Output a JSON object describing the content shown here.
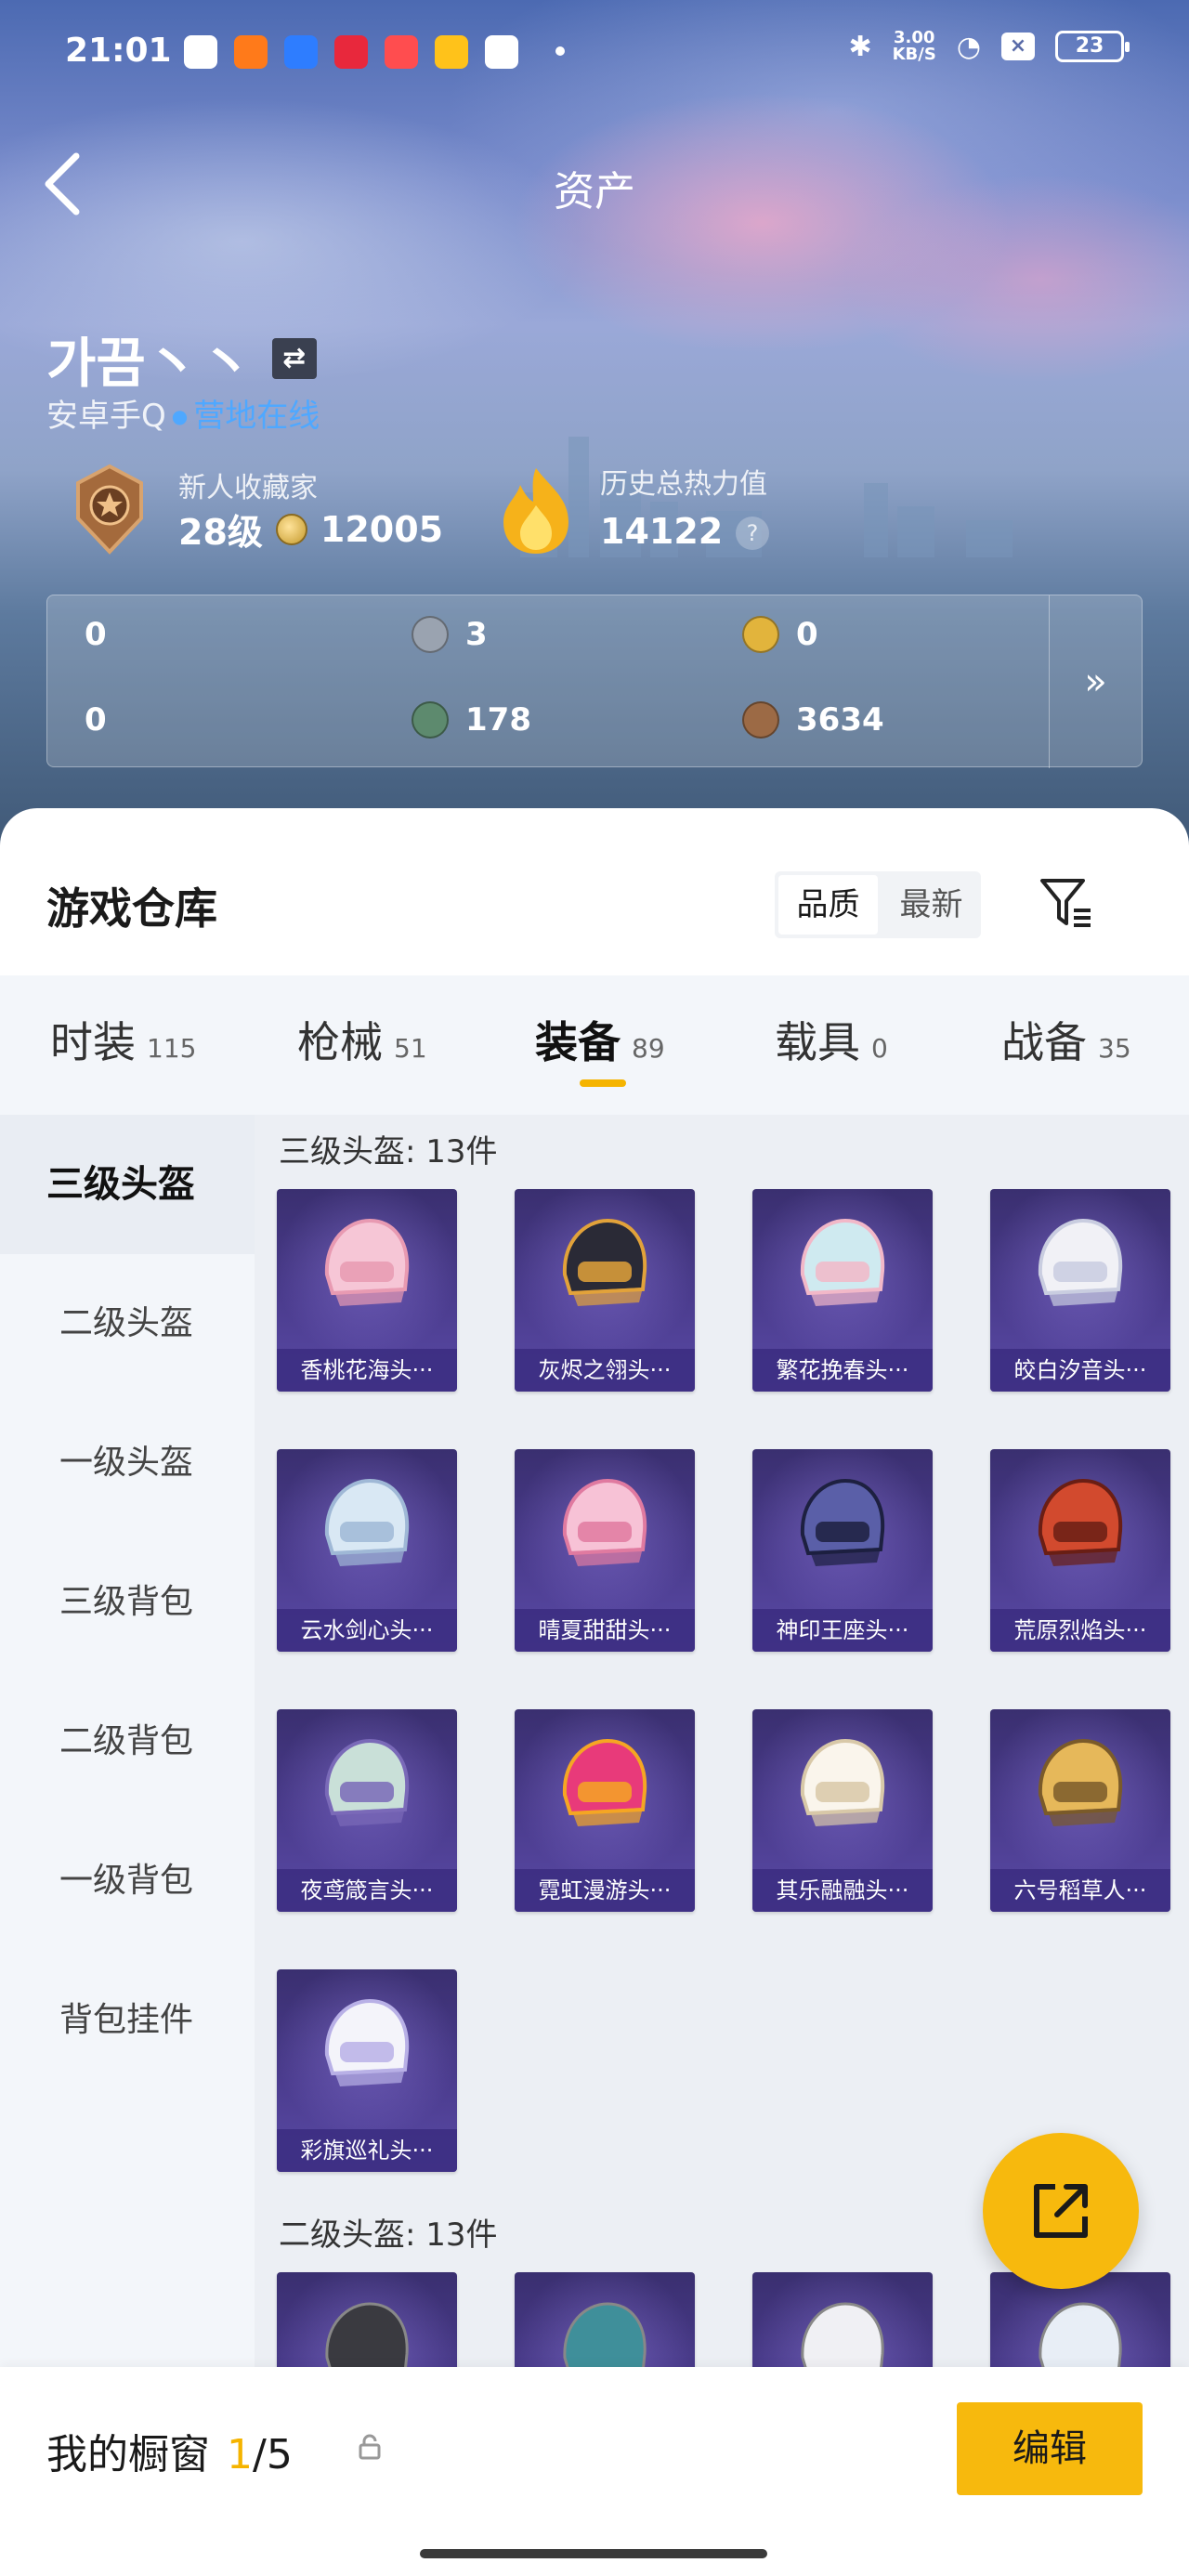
{
  "status_bar": {
    "time": "21:01",
    "net_speed_value": "3.00",
    "net_speed_unit": "KB/S",
    "battery": "23"
  },
  "header": {
    "title": "资产"
  },
  "profile": {
    "name": "가끔丶丶",
    "platform": "安卓手Q",
    "online_status": "营地在线"
  },
  "stats": {
    "collector_label": "新人收藏家",
    "collector_level": "28级",
    "collector_points": "12005",
    "heat_label": "历史总热力值",
    "heat_value": "14122"
  },
  "currencies": [
    {
      "icon": "purple-card-icon",
      "value": "0"
    },
    {
      "icon": "silver-coin-icon",
      "value": "3"
    },
    {
      "icon": "gold-coin-icon",
      "value": "0"
    },
    {
      "icon": "green-card-icon",
      "value": "0"
    },
    {
      "icon": "green-coin-icon",
      "value": "178"
    },
    {
      "icon": "bronze-coin-icon",
      "value": "3634"
    }
  ],
  "warehouse": {
    "title": "游戏仓库",
    "sort_options": [
      "品质",
      "最新"
    ],
    "sort_active": "品质"
  },
  "tabs": [
    {
      "label": "时装",
      "count": "115"
    },
    {
      "label": "枪械",
      "count": "51"
    },
    {
      "label": "装备",
      "count": "89"
    },
    {
      "label": "载具",
      "count": "0"
    },
    {
      "label": "战备",
      "count": "35"
    }
  ],
  "active_tab": "装备",
  "side_menu": [
    "三级头盔",
    "二级头盔",
    "一级头盔",
    "三级背包",
    "二级背包",
    "一级背包",
    "背包挂件"
  ],
  "sections": [
    {
      "title": "三级头盔: 13件",
      "items": [
        "香桃花海头···",
        "灰烬之翎头···",
        "繁花挽春头···",
        "皎白汐音头···",
        "云水剑心头···",
        "晴夏甜甜头···",
        "神印王座头···",
        "荒原烈焰头···",
        "夜鸢箴言头···",
        "霓虹漫游头···",
        "其乐融融头···",
        "六号稻草人···",
        "彩旗巡礼头···"
      ]
    },
    {
      "title": "二级头盔: 13件",
      "items": []
    }
  ],
  "showcase": {
    "label": "我的橱窗",
    "current": "1",
    "total": "/5",
    "edit_label": "编辑"
  },
  "colors": {
    "accent": "#f7b90d",
    "online": "#4fa8ff",
    "item_bg": "#4b3c8e"
  }
}
